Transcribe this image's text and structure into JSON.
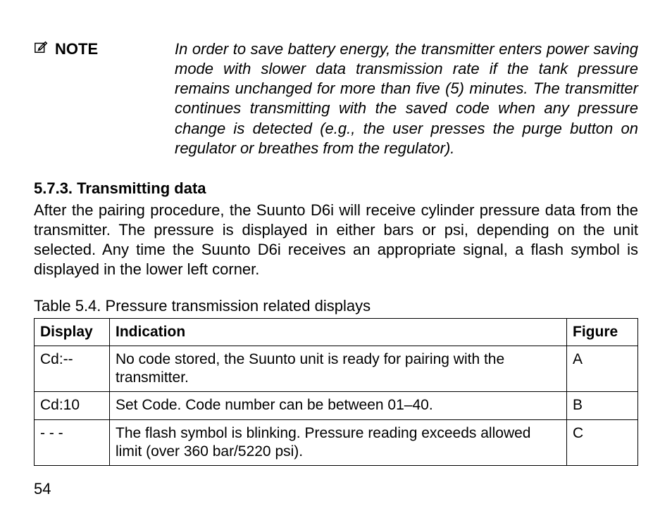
{
  "note": {
    "label": "NOTE",
    "body": "In order to save battery energy, the transmitter enters power saving mode with slower data transmission rate if the tank pressure remains unchanged for more than five (5) minutes. The transmitter continues transmitting with the saved code when any pressure change is detected (e.g., the user presses the purge button on regulator or breathes from the regulator)."
  },
  "section": {
    "heading": "5.7.3. Transmitting data",
    "paragraph": "After the pairing procedure, the Suunto D6i will receive cylinder pressure data from the transmitter. The pressure is displayed in either bars or psi, depending on the unit selected. Any time the Suunto D6i receives an appropriate signal, a flash symbol is displayed in the lower left corner."
  },
  "table": {
    "caption": "Table 5.4. Pressure transmission related displays",
    "headers": {
      "display": "Display",
      "indication": "Indication",
      "figure": "Figure"
    },
    "rows": [
      {
        "display": "Cd:--",
        "indication": "No code stored, the Suunto unit is ready for pairing with the transmitter.",
        "figure": "A"
      },
      {
        "display": "Cd:10",
        "indication": "Set Code. Code number can be between 01–40.",
        "figure": "B"
      },
      {
        "display": "- - -",
        "indication": "The flash symbol is blinking. Pressure reading exceeds allowed limit (over 360 bar/5220 psi).",
        "figure": "C"
      }
    ]
  },
  "page_number": "54"
}
